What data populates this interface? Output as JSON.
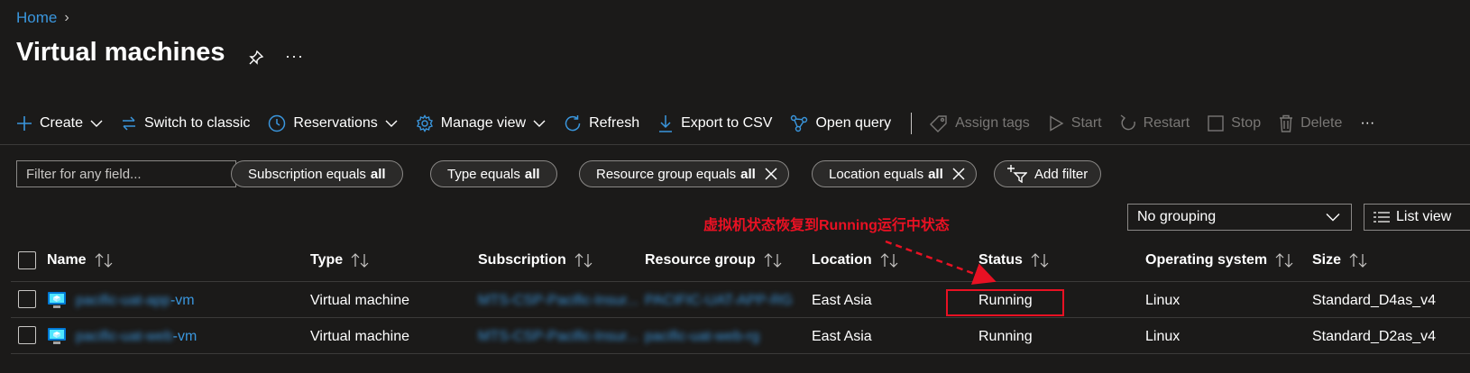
{
  "breadcrumb": {
    "home": "Home"
  },
  "page": {
    "title": "Virtual machines",
    "more": "···"
  },
  "toolbar": {
    "create": "Create",
    "switch_classic": "Switch to classic",
    "reservations": "Reservations",
    "manage_view": "Manage view",
    "refresh": "Refresh",
    "export_csv": "Export to CSV",
    "open_query": "Open query",
    "assign_tags": "Assign tags",
    "start": "Start",
    "restart": "Restart",
    "stop": "Stop",
    "delete": "Delete",
    "more": "···"
  },
  "filters": {
    "search_placeholder": "Filter for any field...",
    "subscription": {
      "label": "Subscription equals",
      "value": "all"
    },
    "type": {
      "label": "Type equals",
      "value": "all"
    },
    "resource_group": {
      "label": "Resource group equals",
      "value": "all"
    },
    "location": {
      "label": "Location equals",
      "value": "all"
    },
    "add_filter": "Add filter"
  },
  "annotation": {
    "text": "虚拟机状态恢复到Running运行中状态",
    "color": "#e81123"
  },
  "view": {
    "grouping": "No grouping",
    "list_view": "List view"
  },
  "table": {
    "columns": {
      "name": "Name",
      "type": "Type",
      "subscription": "Subscription",
      "resource_group": "Resource group",
      "location": "Location",
      "status": "Status",
      "os": "Operating system",
      "size": "Size"
    },
    "rows": [
      {
        "name_blurred": "pacific-uat-app",
        "name_suffix": "-vm",
        "type": "Virtual machine",
        "subscription": "MTS-CSP-Pacific-Insur...",
        "resource_group": "PACIFIC-UAT-APP-RG",
        "location": "East Asia",
        "status": "Running",
        "os": "Linux",
        "size": "Standard_D4as_v4"
      },
      {
        "name_blurred": "pacific-uat-web",
        "name_suffix": "-vm",
        "type": "Virtual machine",
        "subscription": "MTS-CSP-Pacific-Insur...",
        "resource_group": "pacific-uat-web-rg",
        "location": "East Asia",
        "status": "Running",
        "os": "Linux",
        "size": "Standard_D2as_v4"
      }
    ]
  },
  "colors": {
    "accent": "#3a96dd",
    "annotation": "#e81123",
    "background": "#1b1a19"
  }
}
